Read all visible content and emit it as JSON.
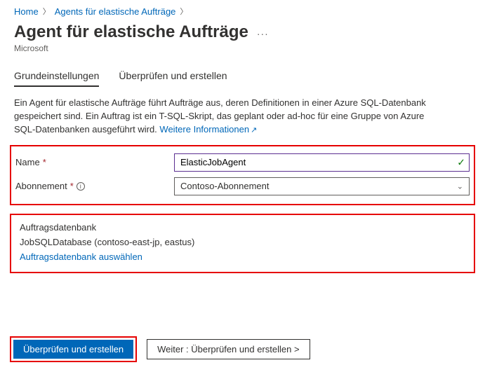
{
  "breadcrumb": {
    "home": "Home",
    "parent": "Agents für elastische Aufträge"
  },
  "header": {
    "title": "Agent für elastische Aufträge",
    "publisher": "Microsoft"
  },
  "tabs": {
    "basics": "Grundeinstellungen",
    "review": "Überprüfen und erstellen"
  },
  "description": {
    "text": "Ein Agent für elastische Aufträge führt Aufträge aus, deren Definitionen in einer Azure SQL-Datenbank gespeichert sind. Ein Auftrag ist ein T-SQL-Skript, das geplant oder ad-hoc für eine Gruppe von Azure SQL-Datenbanken ausgeführt wird.",
    "learn_more": "Weitere Informationen"
  },
  "form": {
    "name_label": "Name",
    "name_value": "ElasticJobAgent",
    "subscription_label": "Abonnement",
    "subscription_value": "Contoso-Abonnement"
  },
  "jobdb": {
    "heading": "Auftragsdatenbank",
    "value": "JobSQLDatabase (contoso-east-jp, eastus)",
    "select_link": "Auftragsdatenbank auswählen"
  },
  "footer": {
    "primary": "Überprüfen und erstellen",
    "secondary": "Weiter : Überprüfen und erstellen >"
  }
}
